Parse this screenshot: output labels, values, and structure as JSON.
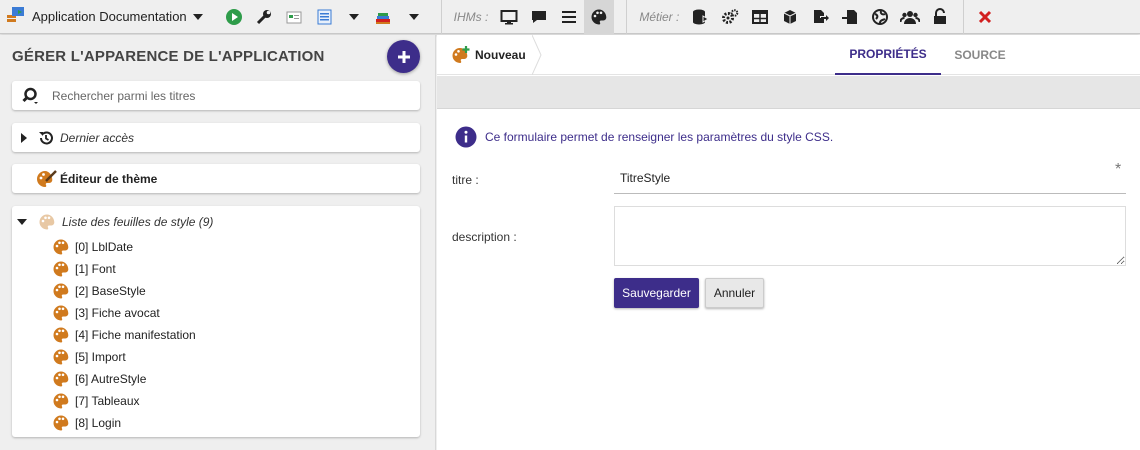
{
  "toolbar": {
    "app_name": "Application Documentation",
    "ihm_label": "IHMs :",
    "metier_label": "Métier :",
    "colors": {
      "run": "#2e9c4a",
      "close": "#d21f1f",
      "accent": "#3d2d8a",
      "palette": "#d07a1e"
    }
  },
  "left": {
    "title": "GÉRER L'APPARENCE DE L'APPLICATION",
    "add_icon": "plus-icon",
    "search": {
      "placeholder": "Rechercher parmi les titres",
      "value": ""
    },
    "recent_label": "Dernier accès",
    "theme_editor_label": "Éditeur de thème",
    "stylesheets": {
      "label": "Liste des feuilles de style (9)",
      "items": [
        {
          "label": "[0] LblDate"
        },
        {
          "label": "[1] Font"
        },
        {
          "label": "[2] BaseStyle"
        },
        {
          "label": "[3] Fiche avocat"
        },
        {
          "label": "[4] Fiche manifestation"
        },
        {
          "label": "[5] Import"
        },
        {
          "label": "[6] AutreStyle"
        },
        {
          "label": "[7] Tableaux"
        },
        {
          "label": "[8] Login"
        }
      ]
    }
  },
  "right": {
    "breadcrumb": "Nouveau",
    "tabs": [
      {
        "label": "PROPRIÉTÉS"
      },
      {
        "label": "SOURCE"
      }
    ],
    "info": "Ce formulaire permet de renseigner les paramètres du style CSS.",
    "form": {
      "titre_label": "titre :",
      "titre_value": "TitreStyle",
      "required_mark": "*",
      "description_label": "description :",
      "description_value": ""
    },
    "buttons": {
      "save": "Sauvegarder",
      "cancel": "Annuler"
    }
  }
}
